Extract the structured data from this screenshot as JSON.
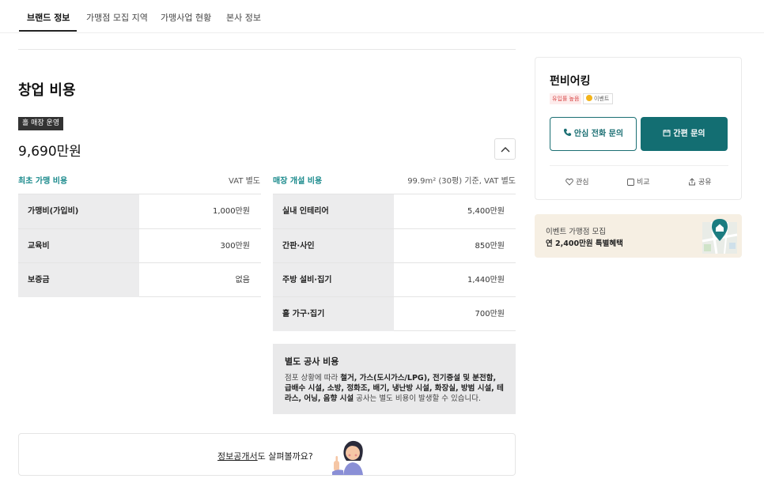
{
  "tabs": [
    {
      "label": "브랜드 정보"
    },
    {
      "label": "가맹점 모집 지역"
    },
    {
      "label": "가맹사업 현황"
    },
    {
      "label": "본사 정보"
    }
  ],
  "section": {
    "title": "창업 비용",
    "store_badge": "홀 매장 운영",
    "total": "9,690만원"
  },
  "initial_cost": {
    "title": "최초 가맹 비용",
    "note": "VAT 별도",
    "rows": [
      {
        "label": "가맹비(가입비)",
        "value": "1,000만원"
      },
      {
        "label": "교육비",
        "value": "300만원"
      },
      {
        "label": "보증금",
        "value": "없음"
      }
    ]
  },
  "store_cost": {
    "title": "매장 개설 비용",
    "note": "99.9m² (30평) 기준, VAT 별도",
    "rows": [
      {
        "label": "실내 인테리어",
        "value": "5,400만원"
      },
      {
        "label": "간판·사인",
        "value": "850만원"
      },
      {
        "label": "주방 설비·집기",
        "value": "1,440만원"
      },
      {
        "label": "홀 가구·집기",
        "value": "700만원"
      }
    ]
  },
  "extra_cost": {
    "title": "별도 공사 비용",
    "prefix": "점포 상황에 따라 ",
    "items": "철거, 가스(도시가스/LPG), 전기증설 및 분전함, 급배수 시설, 소방, 정화조, 배기, 냉난방 시설, 화장실, 방범 시설, 테라스, 어닝, 음향 시설",
    "suffix": " 공사는 별도 비용이 발생할 수 있습니다."
  },
  "disclosure": {
    "link": "정보공개서",
    "text": "도 살펴볼까요?"
  },
  "card": {
    "brand": "펀비어킹",
    "tag_popular": "유입률 높음",
    "tag_event": "이벤트",
    "call_button": "안심 전화 문의",
    "quick_button": "간편 문의",
    "like": "관심",
    "compare": "비교",
    "share": "공유"
  },
  "promo": {
    "line1": "이벤트 가맹점 모집",
    "line2": "연 2,400만원 특별혜택"
  },
  "colors": {
    "accent": "#136e72",
    "accent_text": "#1a8a8c",
    "label_bg": "#ececed",
    "promo_bg": "#f6efe3"
  }
}
